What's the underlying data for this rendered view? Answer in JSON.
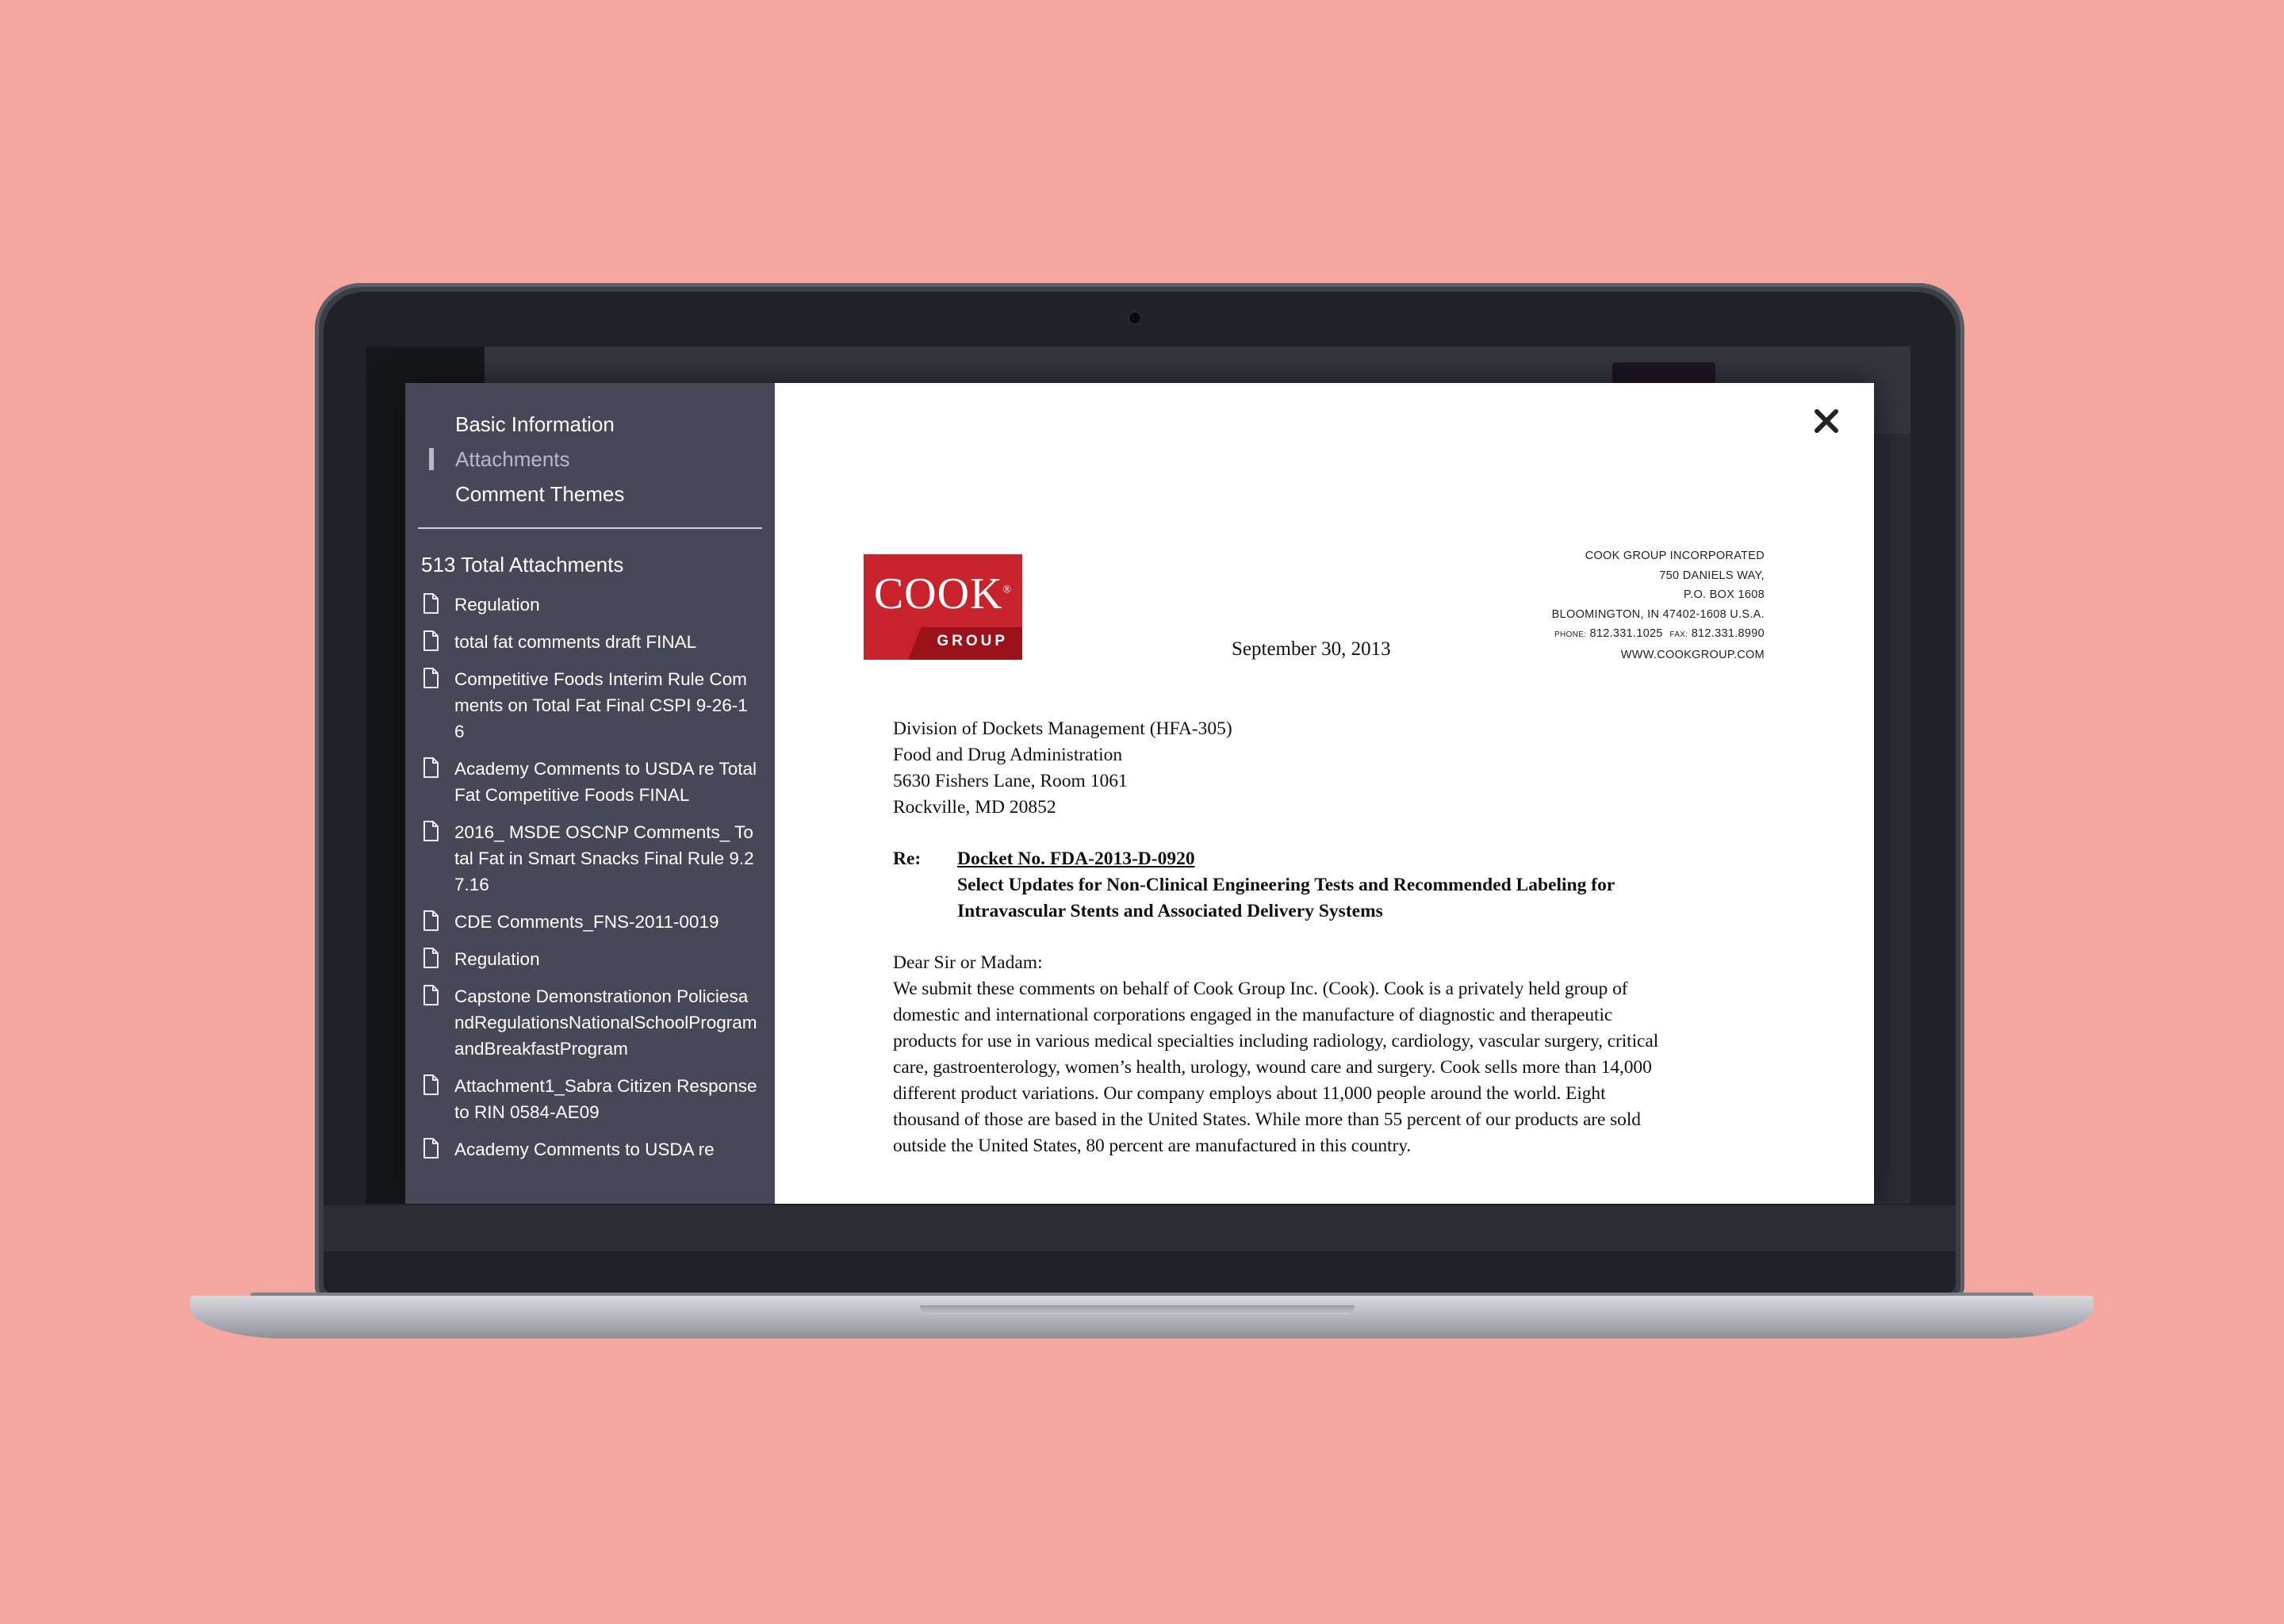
{
  "sidebar": {
    "nav": [
      {
        "label": "Basic Information",
        "active": false
      },
      {
        "label": "Attachments",
        "active": true
      },
      {
        "label": "Comment Themes",
        "active": false
      }
    ],
    "attachments_count": "513 Total Attachments",
    "attachments": [
      "Regulation",
      "total fat comments draft FINAL",
      "Competitive Foods Interim Rule Comments on Total Fat Final CSPI 9-26-16",
      "Academy Comments to USDA re Total Fat Competitive Foods FINAL",
      "2016_ MSDE OSCNP Comments_ Total Fat in Smart Snacks Final Rule 9.27.16",
      "CDE Comments_FNS-2011-0019",
      "Regulation",
      "Capstone Demonstrationon PoliciesandRegulationsNationalSchoolProgramandBreakfastProgram",
      "Attachment1_Sabra Citizen Response to RIN 0584-AE09",
      "Academy Comments to USDA re"
    ]
  },
  "document": {
    "logo": {
      "word": "COOK",
      "registered": "®",
      "group": "GROUP"
    },
    "letterhead": {
      "company": "COOK GROUP INCORPORATED",
      "street": "750 DANIELS WAY,",
      "po_box": "P.O. BOX 1608",
      "city": "BLOOMINGTON, IN 47402-1608 U.S.A.",
      "phone_label": "PHONE:",
      "phone": "812.331.1025",
      "fax_label": "FAX:",
      "fax": "812.331.8990",
      "web": "WWW.COOKGROUP.COM"
    },
    "date": "September 30, 2013",
    "address_lines": [
      "Division of Dockets Management (HFA-305)",
      "Food and Drug Administration",
      "5630 Fishers Lane, Room 1061",
      "Rockville, MD 20852"
    ],
    "re_label": "Re:",
    "re_docket": "Docket No. FDA-2013-D-0920",
    "re_subject_1": "Select Updates for Non-Clinical Engineering Tests and Recommended Labeling for",
    "re_subject_2": "Intravascular Stents and Associated Delivery Systems",
    "salutation": "Dear Sir or Madam:",
    "paragraph_lines": [
      "We submit these comments on behalf of Cook Group Inc. (Cook).  Cook is a privately held group of",
      "domestic and international corporations engaged in the manufacture of diagnostic and therapeutic",
      "products for use in various medical specialties including radiology, cardiology, vascular surgery, critical",
      "care, gastroenterology, women’s health, urology, wound care and surgery.  Cook sells more than 14,000",
      "different product variations.  Our company employs about 11,000 people around the world.  Eight",
      "thousand of those are based in the United States.  While more than 55 percent of our products are sold",
      "outside the United States, 80 percent are manufactured in this country."
    ]
  },
  "colors": {
    "background": "#f5a79f",
    "sidebar": "#474757",
    "logo_red": "#c8222c"
  },
  "icons": {
    "close": "close-icon",
    "attachment": "document-icon"
  }
}
